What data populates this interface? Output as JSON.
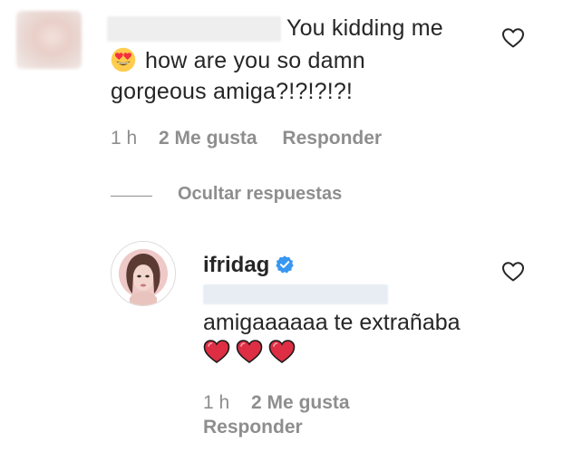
{
  "comment": {
    "text_line1": "You kidding me",
    "text_line2": "how are you so damn",
    "text_line3": "gorgeous amiga?!?!?!?!",
    "emoji": "heart-eyes-emoji",
    "time": "1 h",
    "likes": "2 Me gusta",
    "reply_label": "Responder"
  },
  "replies_toggle": {
    "label": "Ocultar respuestas"
  },
  "reply": {
    "username": "ifridag",
    "verified": true,
    "text": "amigaaaaaa te extrañaba",
    "emojis": [
      "red-heart-emoji",
      "red-heart-emoji",
      "red-heart-emoji"
    ],
    "time": "1 h",
    "likes": "2 Me gusta",
    "reply_label": "Responder"
  },
  "icons": {
    "like": "heart-outline-icon",
    "verified": "verified-badge-icon"
  },
  "colors": {
    "text": "#262626",
    "muted": "#8e8e8e",
    "verified_blue": "#3897f0",
    "heart_red": "#dd2e44"
  }
}
